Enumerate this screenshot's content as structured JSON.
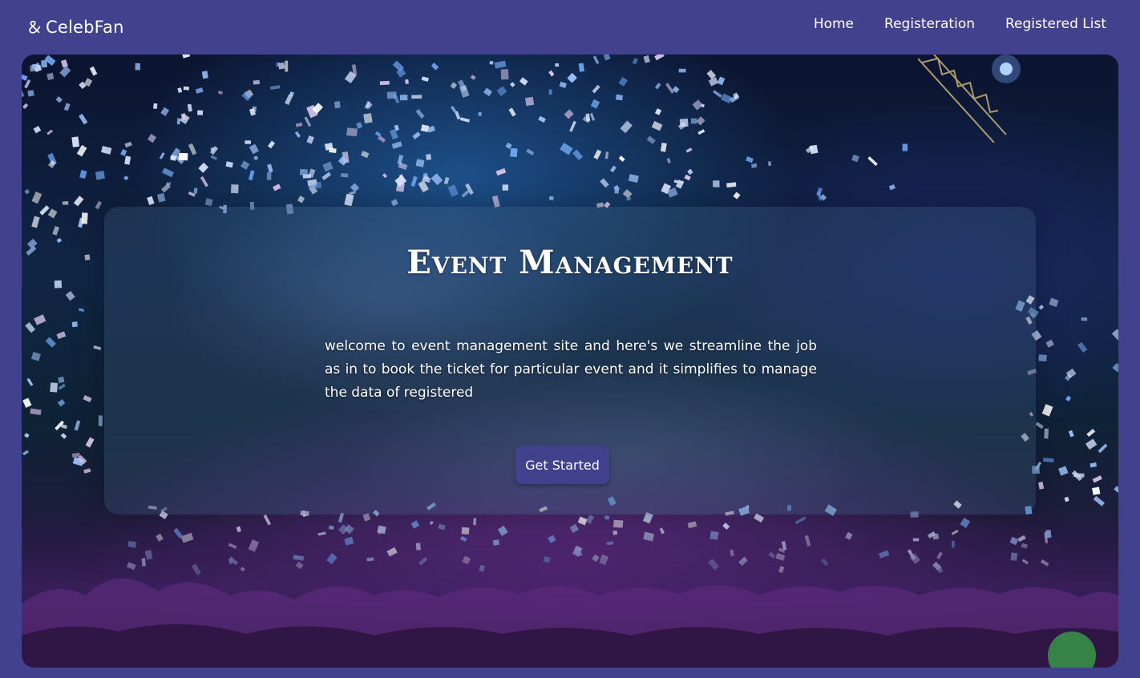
{
  "brand": {
    "name": "CelebFan",
    "icon": "ampersand-logo-icon"
  },
  "nav": {
    "links": [
      {
        "label": "Home"
      },
      {
        "label": "Registeration"
      },
      {
        "label": "Registered List"
      }
    ]
  },
  "hero": {
    "title": "Event Management",
    "description": "welcome to event management site and here's we streamline the job as in to book the ticket for particular event and it simplifies to manage the data of registered",
    "cta_label": "Get Started"
  },
  "colors": {
    "brand_purple": "#42418e",
    "text": "#ffffff"
  }
}
